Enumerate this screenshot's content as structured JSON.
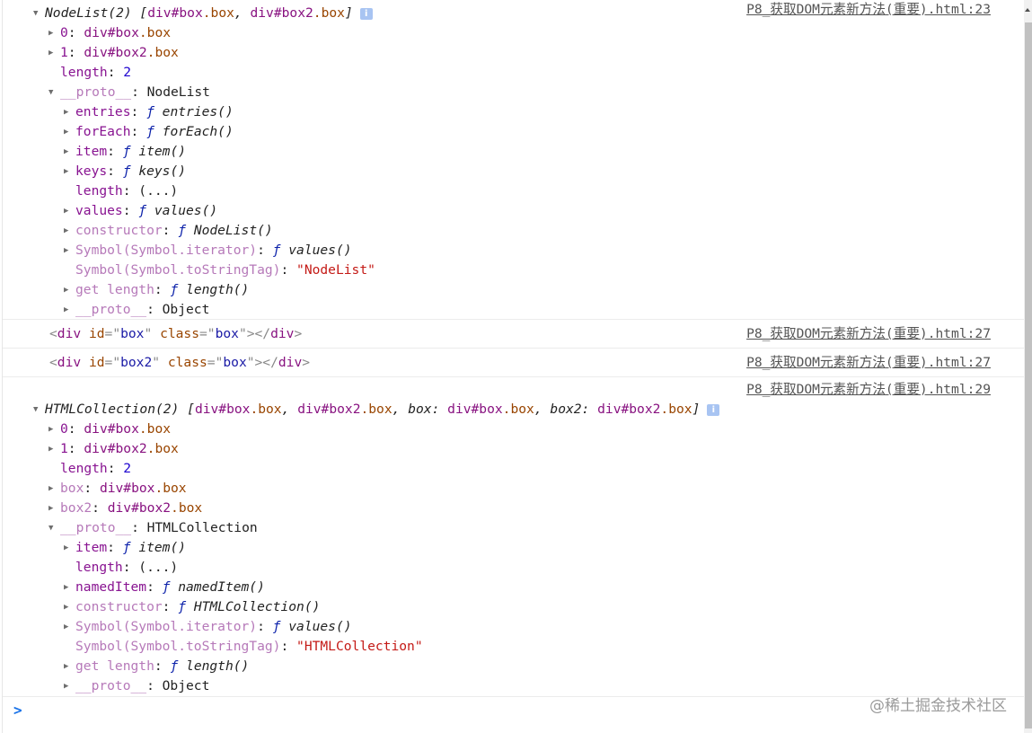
{
  "groups": {
    "nodelist": {
      "source": "P8_获取DOM元素新方法(重要).html:23",
      "lines": [
        {
          "lvl": 0,
          "tog": "open",
          "info": true,
          "t": [
            [
              "it",
              "NodeList(2) ["
            ],
            [
              "tag",
              "div#box"
            ],
            [
              "cls",
              ".box"
            ],
            [
              "it",
              ", "
            ],
            [
              "tag",
              "div#box2"
            ],
            [
              "cls",
              ".box"
            ],
            [
              "it",
              "]"
            ]
          ]
        },
        {
          "lvl": 1,
          "tog": "closed",
          "t": [
            [
              "k",
              "0"
            ],
            [
              "p",
              ": "
            ],
            [
              "tag",
              "div#box"
            ],
            [
              "cls",
              ".box"
            ]
          ]
        },
        {
          "lvl": 1,
          "tog": "closed",
          "t": [
            [
              "k",
              "1"
            ],
            [
              "p",
              ": "
            ],
            [
              "tag",
              "div#box2"
            ],
            [
              "cls",
              ".box"
            ]
          ]
        },
        {
          "lvl": 1,
          "tog": null,
          "t": [
            [
              "k",
              "length"
            ],
            [
              "p",
              ": "
            ],
            [
              "n",
              "2"
            ]
          ]
        },
        {
          "lvl": 1,
          "tog": "open",
          "t": [
            [
              "kg",
              "__proto__"
            ],
            [
              "p",
              ": NodeList"
            ]
          ]
        },
        {
          "lvl": 2,
          "tog": "closed",
          "t": [
            [
              "k",
              "entries"
            ],
            [
              "p",
              ": "
            ],
            [
              "f",
              "ƒ "
            ],
            [
              "fi",
              "entries()"
            ]
          ]
        },
        {
          "lvl": 2,
          "tog": "closed",
          "t": [
            [
              "k",
              "forEach"
            ],
            [
              "p",
              ": "
            ],
            [
              "f",
              "ƒ "
            ],
            [
              "fi",
              "forEach()"
            ]
          ]
        },
        {
          "lvl": 2,
          "tog": "closed",
          "t": [
            [
              "k",
              "item"
            ],
            [
              "p",
              ": "
            ],
            [
              "f",
              "ƒ "
            ],
            [
              "fi",
              "item()"
            ]
          ]
        },
        {
          "lvl": 2,
          "tog": "closed",
          "t": [
            [
              "k",
              "keys"
            ],
            [
              "p",
              ": "
            ],
            [
              "f",
              "ƒ "
            ],
            [
              "fi",
              "keys()"
            ]
          ]
        },
        {
          "lvl": 2,
          "tog": null,
          "t": [
            [
              "k",
              "length"
            ],
            [
              "p",
              ": (...)"
            ]
          ]
        },
        {
          "lvl": 2,
          "tog": "closed",
          "t": [
            [
              "k",
              "values"
            ],
            [
              "p",
              ": "
            ],
            [
              "f",
              "ƒ "
            ],
            [
              "fi",
              "values()"
            ]
          ]
        },
        {
          "lvl": 2,
          "tog": "closed",
          "t": [
            [
              "kg",
              "constructor"
            ],
            [
              "p",
              ": "
            ],
            [
              "f",
              "ƒ "
            ],
            [
              "fi",
              "NodeList()"
            ]
          ]
        },
        {
          "lvl": 2,
          "tog": "closed",
          "t": [
            [
              "kg",
              "Symbol(Symbol.iterator)"
            ],
            [
              "p",
              ": "
            ],
            [
              "f",
              "ƒ "
            ],
            [
              "fi",
              "values()"
            ]
          ]
        },
        {
          "lvl": 2,
          "tog": null,
          "t": [
            [
              "kg",
              "Symbol(Symbol.toStringTag)"
            ],
            [
              "p",
              ": "
            ],
            [
              "s",
              "\"NodeList\""
            ]
          ]
        },
        {
          "lvl": 2,
          "tog": "closed",
          "t": [
            [
              "kg",
              "get length"
            ],
            [
              "p",
              ": "
            ],
            [
              "f",
              "ƒ "
            ],
            [
              "fi",
              "length()"
            ]
          ]
        },
        {
          "lvl": 2,
          "tog": "closed",
          "t": [
            [
              "kg",
              "__proto__"
            ],
            [
              "p",
              ": Object"
            ]
          ]
        }
      ]
    },
    "div1": {
      "source": "P8_获取DOM元素新方法(重要).html:27",
      "t": [
        [
          "pu",
          "<"
        ],
        [
          "tag",
          "div"
        ],
        [
          "p",
          " "
        ],
        [
          "an",
          "id"
        ],
        [
          "pu",
          "=\""
        ],
        [
          "av",
          "box"
        ],
        [
          "pu",
          "\""
        ],
        [
          "p",
          " "
        ],
        [
          "an",
          "class"
        ],
        [
          "pu",
          "=\""
        ],
        [
          "av",
          "box"
        ],
        [
          "pu",
          "\"></"
        ],
        [
          "tag",
          "div"
        ],
        [
          "pu",
          ">"
        ]
      ]
    },
    "div2": {
      "source": "P8_获取DOM元素新方法(重要).html:27",
      "t": [
        [
          "pu",
          "<"
        ],
        [
          "tag",
          "div"
        ],
        [
          "p",
          " "
        ],
        [
          "an",
          "id"
        ],
        [
          "pu",
          "=\""
        ],
        [
          "av",
          "box2"
        ],
        [
          "pu",
          "\""
        ],
        [
          "p",
          " "
        ],
        [
          "an",
          "class"
        ],
        [
          "pu",
          "=\""
        ],
        [
          "av",
          "box"
        ],
        [
          "pu",
          "\"></"
        ],
        [
          "tag",
          "div"
        ],
        [
          "pu",
          ">"
        ]
      ]
    },
    "htmlcollection": {
      "source": "P8_获取DOM元素新方法(重要).html:29",
      "lines": [
        {
          "lvl": 0,
          "tog": "open",
          "info": true,
          "t": [
            [
              "it",
              "HTMLCollection(2) ["
            ],
            [
              "tag",
              "div#box"
            ],
            [
              "cls",
              ".box"
            ],
            [
              "it",
              ", "
            ],
            [
              "tag",
              "div#box2"
            ],
            [
              "cls",
              ".box"
            ],
            [
              "it",
              ", "
            ],
            [
              "it",
              "box: "
            ],
            [
              "tag",
              "div#box"
            ],
            [
              "cls",
              ".box"
            ],
            [
              "it",
              ", "
            ],
            [
              "it",
              "box2: "
            ],
            [
              "tag",
              "div#box2"
            ],
            [
              "cls",
              ".box"
            ],
            [
              "it",
              "]"
            ]
          ]
        },
        {
          "lvl": 1,
          "tog": "closed",
          "t": [
            [
              "k",
              "0"
            ],
            [
              "p",
              ": "
            ],
            [
              "tag",
              "div#box"
            ],
            [
              "cls",
              ".box"
            ]
          ]
        },
        {
          "lvl": 1,
          "tog": "closed",
          "t": [
            [
              "k",
              "1"
            ],
            [
              "p",
              ": "
            ],
            [
              "tag",
              "div#box2"
            ],
            [
              "cls",
              ".box"
            ]
          ]
        },
        {
          "lvl": 1,
          "tog": null,
          "t": [
            [
              "k",
              "length"
            ],
            [
              "p",
              ": "
            ],
            [
              "n",
              "2"
            ]
          ]
        },
        {
          "lvl": 1,
          "tog": "closed",
          "t": [
            [
              "kg",
              "box"
            ],
            [
              "p",
              ": "
            ],
            [
              "tag",
              "div#box"
            ],
            [
              "cls",
              ".box"
            ]
          ]
        },
        {
          "lvl": 1,
          "tog": "closed",
          "t": [
            [
              "kg",
              "box2"
            ],
            [
              "p",
              ": "
            ],
            [
              "tag",
              "div#box2"
            ],
            [
              "cls",
              ".box"
            ]
          ]
        },
        {
          "lvl": 1,
          "tog": "open",
          "t": [
            [
              "kg",
              "__proto__"
            ],
            [
              "p",
              ": HTMLCollection"
            ]
          ]
        },
        {
          "lvl": 2,
          "tog": "closed",
          "t": [
            [
              "k",
              "item"
            ],
            [
              "p",
              ": "
            ],
            [
              "f",
              "ƒ "
            ],
            [
              "fi",
              "item()"
            ]
          ]
        },
        {
          "lvl": 2,
          "tog": null,
          "t": [
            [
              "k",
              "length"
            ],
            [
              "p",
              ": (...)"
            ]
          ]
        },
        {
          "lvl": 2,
          "tog": "closed",
          "t": [
            [
              "k",
              "namedItem"
            ],
            [
              "p",
              ": "
            ],
            [
              "f",
              "ƒ "
            ],
            [
              "fi",
              "namedItem()"
            ]
          ]
        },
        {
          "lvl": 2,
          "tog": "closed",
          "t": [
            [
              "kg",
              "constructor"
            ],
            [
              "p",
              ": "
            ],
            [
              "f",
              "ƒ "
            ],
            [
              "fi",
              "HTMLCollection()"
            ]
          ]
        },
        {
          "lvl": 2,
          "tog": "closed",
          "t": [
            [
              "kg",
              "Symbol(Symbol.iterator)"
            ],
            [
              "p",
              ": "
            ],
            [
              "f",
              "ƒ "
            ],
            [
              "fi",
              "values()"
            ]
          ]
        },
        {
          "lvl": 2,
          "tog": null,
          "t": [
            [
              "kg",
              "Symbol(Symbol.toStringTag)"
            ],
            [
              "p",
              ": "
            ],
            [
              "s",
              "\"HTMLCollection\""
            ]
          ]
        },
        {
          "lvl": 2,
          "tog": "closed",
          "t": [
            [
              "kg",
              "get length"
            ],
            [
              "p",
              ": "
            ],
            [
              "f",
              "ƒ "
            ],
            [
              "fi",
              "length()"
            ]
          ]
        },
        {
          "lvl": 2,
          "tog": "closed",
          "t": [
            [
              "kg",
              "__proto__"
            ],
            [
              "p",
              ": Object"
            ]
          ]
        }
      ]
    }
  },
  "prompt_symbol": ">",
  "info_icon": "i",
  "watermark": "@稀土掘金技术社区"
}
